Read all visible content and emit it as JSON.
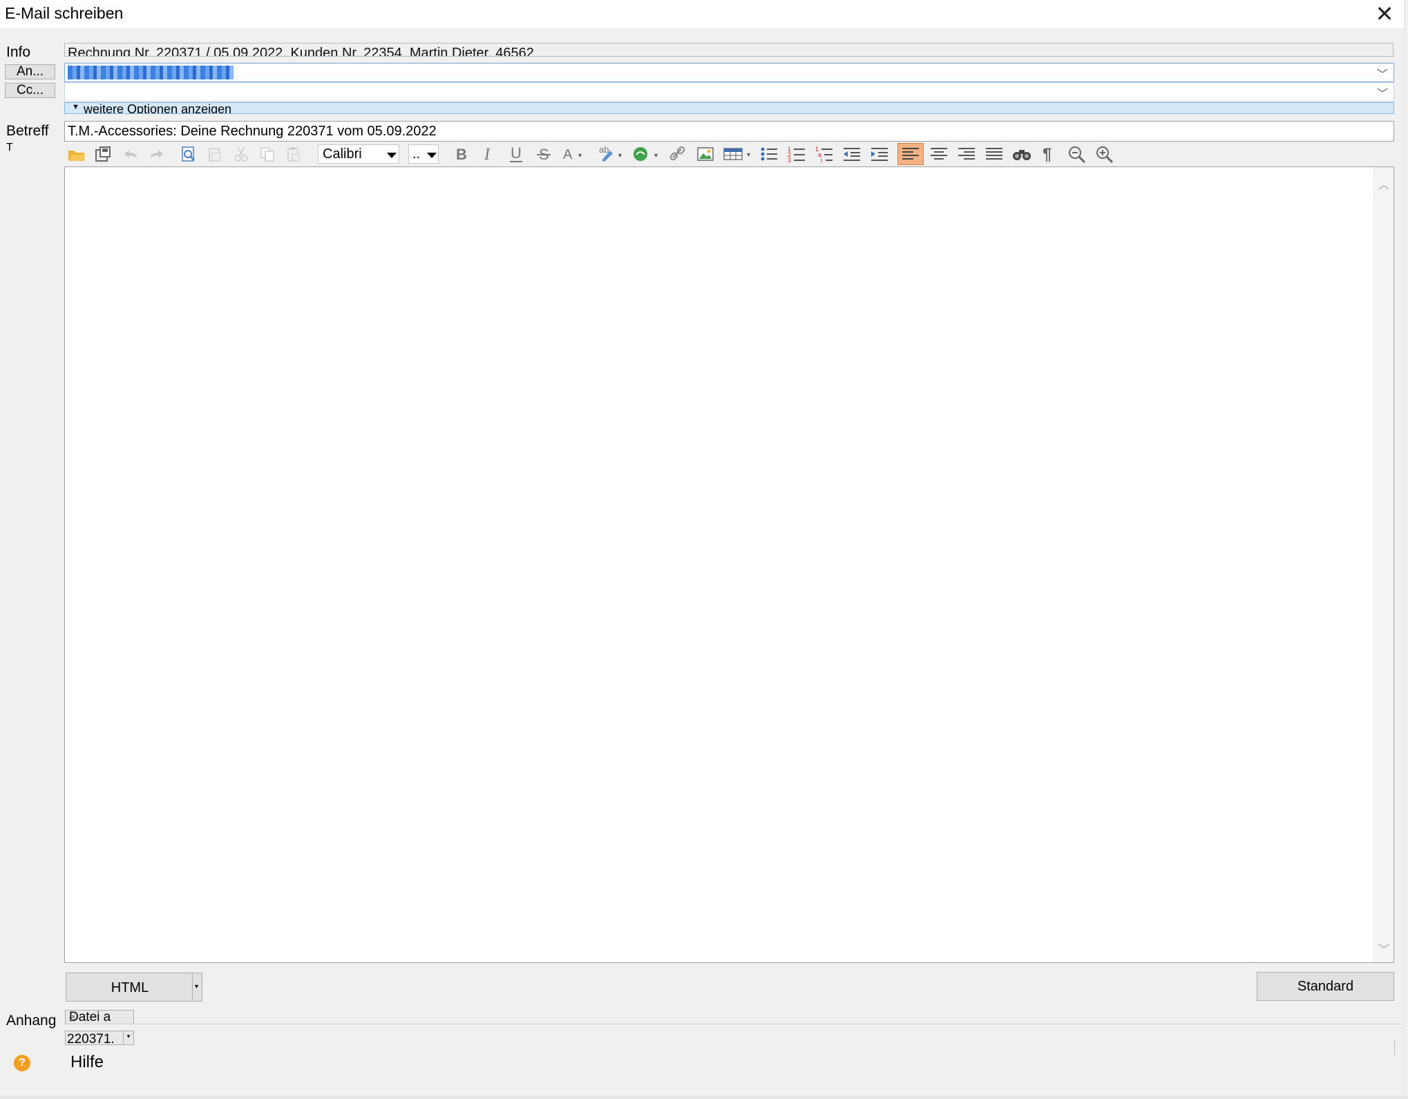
{
  "window": {
    "title": "E-Mail schreiben"
  },
  "labels": {
    "info": "Info",
    "betreff": "Betreff",
    "anhang": "Anhang",
    "stray": "T"
  },
  "info_value": "Rechnung Nr. 220371 / 05.09.2022, Kunden Nr. 22354, Martin Dieter, 46562",
  "recipients": {
    "to_button": "An...",
    "cc_button": "Cc...",
    "to_value": "",
    "cc_value": ""
  },
  "options_toggle": "weitere Optionen anzeigen",
  "subject": "T.M.-Accessories: Deine Rechnung 220371 vom 05.09.2022",
  "toolbar": {
    "font": "Calibri",
    "size": "..",
    "icons": [
      "open-folder-icon",
      "save-icon",
      "undo-icon",
      "redo-icon",
      "print-preview-icon",
      "paste-special-icon",
      "cut-icon",
      "copy-icon",
      "paste-icon",
      "bold-icon",
      "italic-icon",
      "underline-icon",
      "strikethrough-icon",
      "font-color-icon",
      "spellcheck-icon",
      "web-link-icon",
      "hyperlink-icon",
      "insert-image-icon",
      "table-icon",
      "bullet-list-icon",
      "numbered-list-icon",
      "multilevel-list-icon",
      "outdent-icon",
      "indent-icon",
      "align-left-icon",
      "align-center-icon",
      "align-right-icon",
      "justify-icon",
      "find-icon",
      "pilcrow-icon",
      "zoom-out-icon",
      "zoom-in-icon"
    ],
    "accent_active": "#f4b183"
  },
  "format_button": "HTML",
  "standard_button": "Standard",
  "attachments": {
    "add_button": "Datei a",
    "file_name": "220371."
  },
  "help": {
    "label": "Hilfe",
    "icon": "help-icon",
    "icon_color": "#f0a020"
  }
}
